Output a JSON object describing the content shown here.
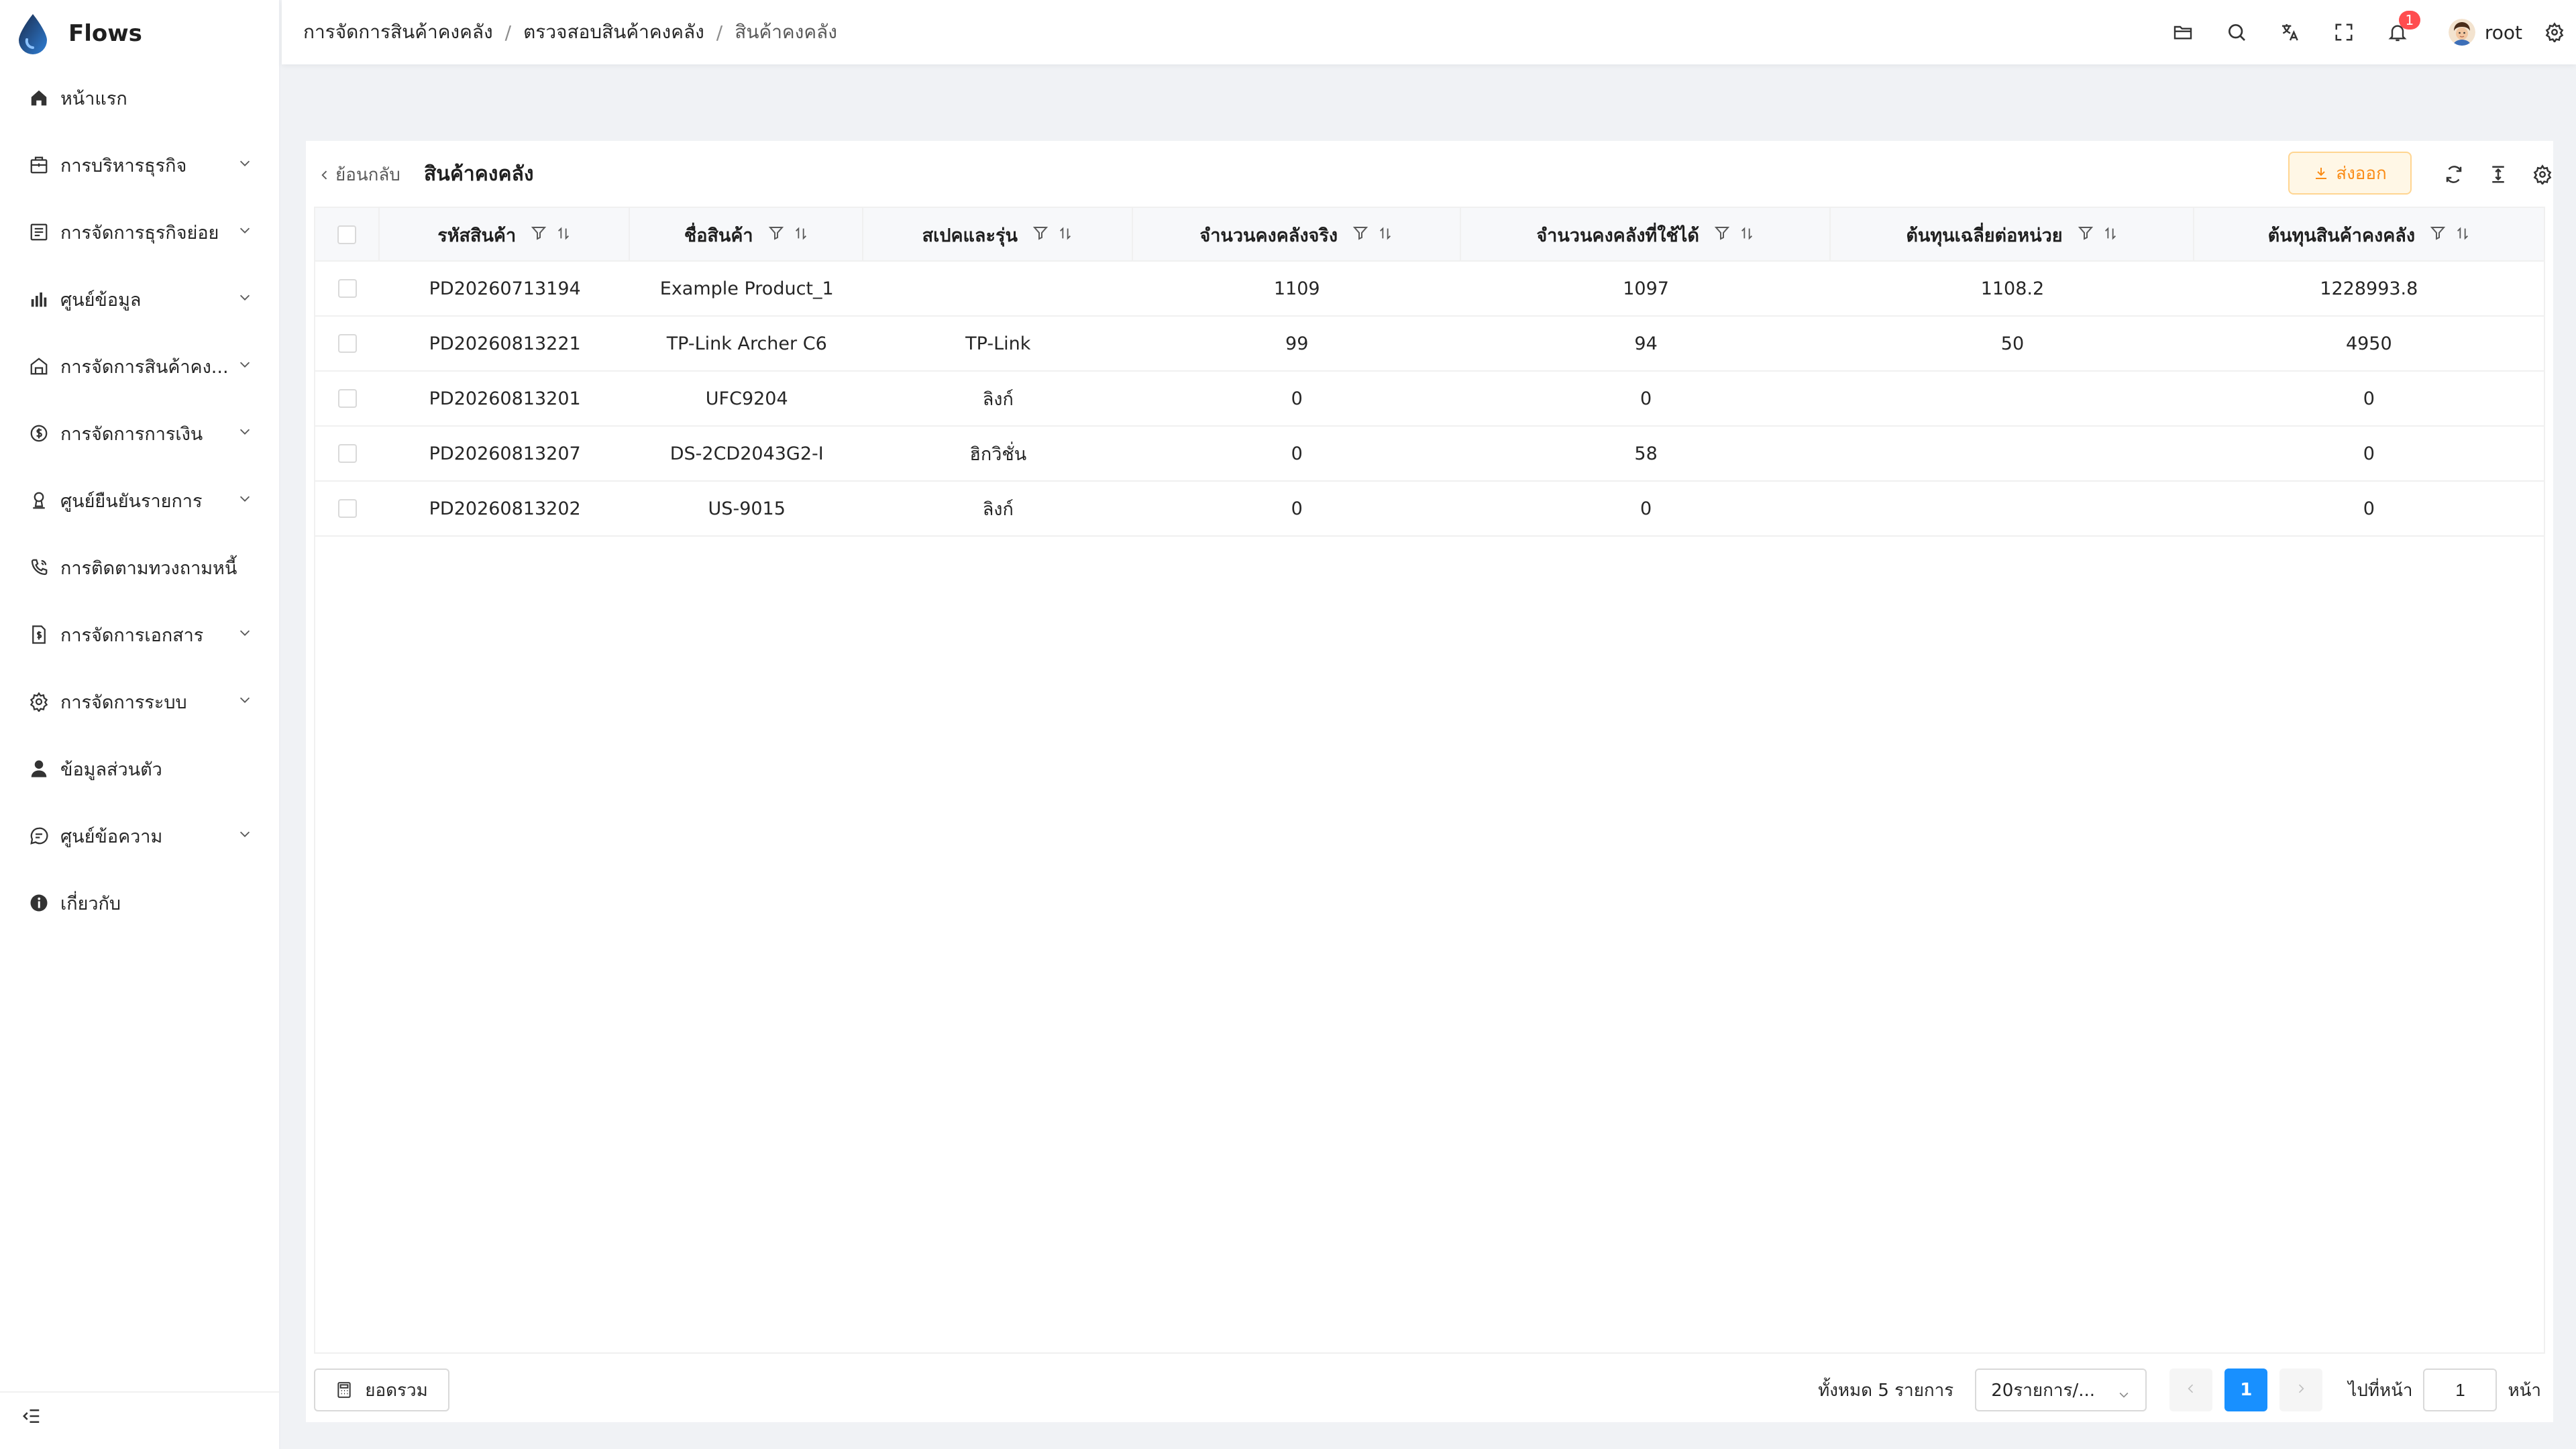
{
  "app": {
    "name": "Flows"
  },
  "sidebar": {
    "items": [
      {
        "label": "หน้าแรก",
        "icon": "home-icon",
        "has_children": false
      },
      {
        "label": "การบริหารธุรกิจ",
        "icon": "briefcase-icon",
        "has_children": true
      },
      {
        "label": "การจัดการธุรกิจย่อย",
        "icon": "document-list-icon",
        "has_children": true
      },
      {
        "label": "ศูนย์ข้อมูล",
        "icon": "bar-chart-icon",
        "has_children": true
      },
      {
        "label": "การจัดการสินค้าคง...",
        "icon": "warehouse-icon",
        "has_children": true
      },
      {
        "label": "การจัดการการเงิน",
        "icon": "dollar-circle-icon",
        "has_children": true
      },
      {
        "label": "ศูนย์ยืนยันรายการ",
        "icon": "audit-icon",
        "has_children": true
      },
      {
        "label": "การติดตามทวงถามหนี้",
        "icon": "phone-icon",
        "has_children": false
      },
      {
        "label": "การจัดการเอกสาร",
        "icon": "file-dollar-icon",
        "has_children": true
      },
      {
        "label": "การจัดการระบบ",
        "icon": "settings-icon",
        "has_children": true
      },
      {
        "label": "ข้อมูลส่วนตัว",
        "icon": "user-icon",
        "has_children": false
      },
      {
        "label": "ศูนย์ข้อความ",
        "icon": "message-icon",
        "has_children": true
      },
      {
        "label": "เกี่ยวกับ",
        "icon": "info-icon",
        "has_children": false
      }
    ]
  },
  "header": {
    "breadcrumb": [
      "การจัดการสินค้าคงคลัง",
      "ตรวจสอบสินค้าคงคลัง",
      "สินค้าคงคลัง"
    ],
    "notification_count": "1",
    "user_name": "root"
  },
  "page": {
    "back_label": "ย้อนกลับ",
    "title": "สินค้าคงคลัง",
    "export_label": "ส่งออก"
  },
  "table": {
    "columns": [
      "รหัสสินค้า",
      "ชื่อสินค้า",
      "สเปคและรุ่น",
      "จำนวนคงคลังจริง",
      "จำนวนคงคลังที่ใช้ได้",
      "ต้นทุนเฉลี่ยต่อหน่วย",
      "ต้นทุนสินค้าคงคลัง"
    ],
    "rows": [
      [
        "PD20260713194",
        "Example Product_1",
        "",
        "1109",
        "1097",
        "1108.2",
        "1228993.8"
      ],
      [
        "PD20260813221",
        "TP-Link Archer C6",
        "TP-Link",
        "99",
        "94",
        "50",
        "4950"
      ],
      [
        "PD20260813201",
        "UFC9204",
        "ลิงก์",
        "0",
        "0",
        "",
        "0"
      ],
      [
        "PD20260813207",
        "DS-2CD2043G2-I",
        "ฮิกวิชั่น",
        "0",
        "58",
        "",
        "0"
      ],
      [
        "PD20260813202",
        "US-9015",
        "ลิงก์",
        "0",
        "0",
        "",
        "0"
      ]
    ]
  },
  "footer": {
    "summary_label": "ยอดรวม",
    "total_text": "ทั้งหมด 5 รายการ",
    "page_size": "20รายการ/...",
    "current_page": "1",
    "goto_label": "ไปที่หน้า",
    "goto_value": "1",
    "goto_suffix": "หน้า"
  },
  "colors": {
    "primary": "#1890ff",
    "export": "#fa8c16",
    "badge": "#ff4d4f"
  }
}
